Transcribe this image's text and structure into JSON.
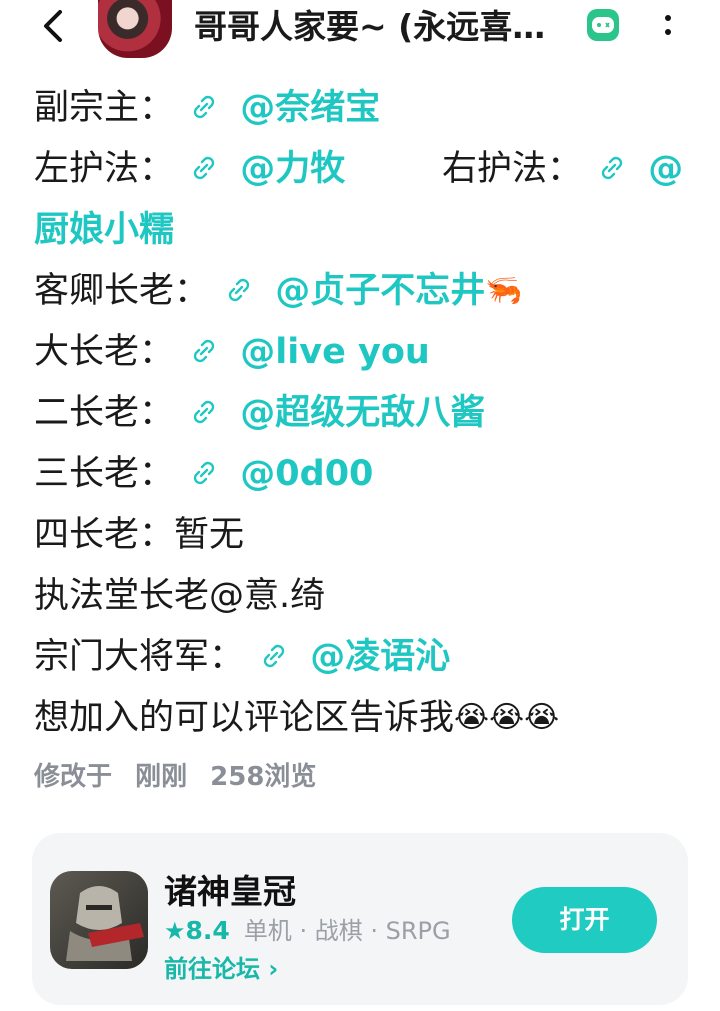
{
  "header": {
    "title": "哥哥人家要~ (永远喜…",
    "avatar_icon": "user-avatar",
    "badge_icon": "game-controller-icon",
    "more_icon": "more-vertical-icon"
  },
  "post": {
    "lines": [
      {
        "label": "副宗主：",
        "mention": "@奈绪宝"
      },
      {
        "label": "左护法：",
        "mention": "@力牧"
      },
      {
        "label": "右护法：",
        "mention_start": "@",
        "mention_cont": "厨娘小糯"
      },
      {
        "label": "客卿长老：",
        "mention": "@贞子不忘井",
        "emoji": "🦐"
      },
      {
        "label": "大长老：",
        "mention": "@live you"
      },
      {
        "label": "二长老：",
        "mention": "@超级无敌八酱"
      },
      {
        "label": "三长老：",
        "mention": "@0d00"
      },
      {
        "text": "四长老：暂无"
      },
      {
        "text": "执法堂长老@意.绮"
      },
      {
        "label": "宗门大将军：",
        "mention": "@凌语沁"
      },
      {
        "text": "想加入的可以评论区告诉我",
        "emoji": "😭😭😭"
      }
    ]
  },
  "meta": {
    "edited": "修改于",
    "time": "刚刚",
    "views": "258浏览"
  },
  "app_card": {
    "name": "诸神皇冠",
    "score": "8.4",
    "tags": "单机 · 战棋 · SRPG",
    "forum_link": "前往论坛 ›",
    "open_button": "打开",
    "accent_color": "#20cbc1"
  }
}
